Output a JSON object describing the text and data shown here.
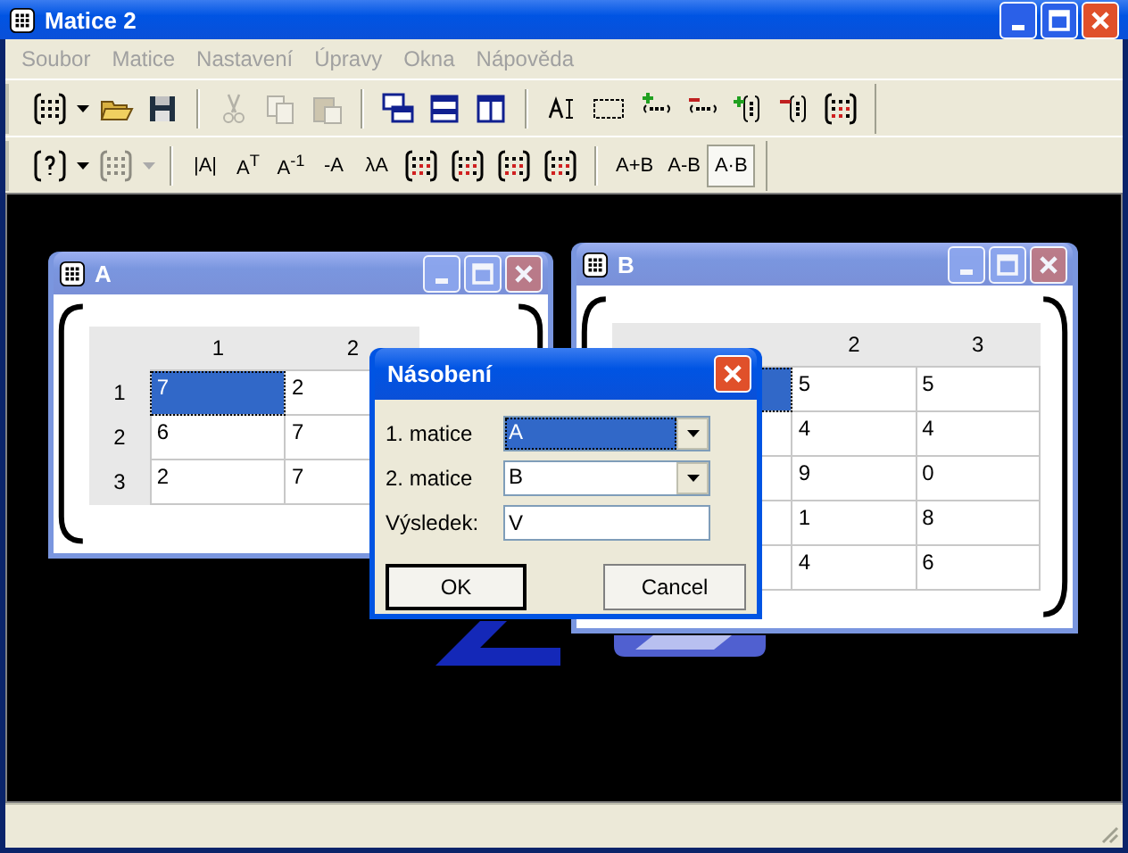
{
  "window": {
    "title": "Matice 2",
    "active": true
  },
  "menu": [
    {
      "label": "Soubor",
      "disabled": true
    },
    {
      "label": "Matice",
      "disabled": true
    },
    {
      "label": "Nastavení",
      "disabled": true
    },
    {
      "label": "Úpravy",
      "disabled": true
    },
    {
      "label": "Okna",
      "disabled": true
    },
    {
      "label": "Nápověda",
      "disabled": true
    }
  ],
  "toolbar_1": [
    [
      {
        "kind": "matrix",
        "disabled": false
      },
      {
        "kind": "caret",
        "disabled": false
      },
      {
        "kind": "folder",
        "disabled": false
      },
      {
        "kind": "disk",
        "disabled": false
      }
    ],
    [
      {
        "kind": "scissors",
        "disabled": true
      },
      {
        "kind": "copy",
        "disabled": true
      },
      {
        "kind": "paste",
        "disabled": true
      }
    ],
    [
      {
        "kind": "cascade",
        "disabled": false
      },
      {
        "kind": "rows",
        "disabled": false
      },
      {
        "kind": "columns",
        "disabled": false
      }
    ],
    [
      {
        "kind": "text-cursor",
        "disabled": false
      },
      {
        "kind": "selection",
        "disabled": false
      },
      {
        "kind": "add-row",
        "disabled": false
      },
      {
        "kind": "remove-row",
        "disabled": false
      },
      {
        "kind": "add-column",
        "disabled": false
      },
      {
        "kind": "remove-column",
        "disabled": false
      },
      {
        "kind": "matrix-op",
        "disabled": false
      }
    ]
  ],
  "toolbar_2": [
    [
      {
        "kind": "help",
        "disabled": false
      },
      {
        "kind": "caret",
        "disabled": false
      },
      {
        "kind": "matrix",
        "disabled": true
      },
      {
        "kind": "caret",
        "disabled": true
      }
    ],
    [
      {
        "kind": "text",
        "label": "|A|",
        "disabled": false,
        "pressed": false
      },
      {
        "kind": "text",
        "label": "A$^{T}$",
        "disabled": false,
        "pressed": false
      },
      {
        "kind": "text",
        "label": "A$^{-1}$",
        "disabled": false,
        "pressed": false
      },
      {
        "kind": "text",
        "label": "-A",
        "disabled": false,
        "pressed": false
      },
      {
        "kind": "text",
        "label": "λA",
        "disabled": false,
        "pressed": false
      },
      {
        "kind": "matrix-op",
        "disabled": false
      },
      {
        "kind": "matrix-op",
        "disabled": false
      },
      {
        "kind": "matrix-op",
        "disabled": false
      },
      {
        "kind": "matrix-op",
        "disabled": false
      }
    ],
    [
      {
        "kind": "text",
        "label": "A+B",
        "disabled": false,
        "pressed": false
      },
      {
        "kind": "text",
        "label": "A-B",
        "disabled": false,
        "pressed": false
      },
      {
        "kind": "text",
        "label": "A·B",
        "disabled": false,
        "pressed": true
      }
    ]
  ],
  "windows": [
    {
      "title": "A",
      "active": false,
      "columns": [
        "1",
        "2"
      ],
      "rows": [
        {
          "header": "1",
          "cells": [
            {
              "text": "7",
              "selected": true
            },
            {
              "text": "2",
              "selected": false
            }
          ]
        },
        {
          "header": "2",
          "cells": [
            {
              "text": "6",
              "selected": false
            },
            {
              "text": "7",
              "selected": false
            }
          ]
        },
        {
          "header": "3",
          "cells": [
            {
              "text": "2",
              "selected": false
            },
            {
              "text": "7",
              "selected": false
            }
          ]
        }
      ]
    },
    {
      "title": "B",
      "active": false,
      "columns": [
        "",
        "2",
        "3"
      ],
      "rows": [
        {
          "cells": [
            {
              "selected": true
            },
            {
              "text": "5",
              "selected": false
            },
            {
              "text": "5",
              "selected": false
            }
          ]
        },
        {
          "cells": [
            {
              "selected": false
            },
            {
              "text": "4",
              "selected": false
            },
            {
              "text": "4",
              "selected": false
            }
          ]
        },
        {
          "cells": [
            {
              "selected": false
            },
            {
              "text": "9",
              "selected": false
            },
            {
              "text": "0",
              "selected": false
            }
          ]
        },
        {
          "cells": [
            {
              "selected": false
            },
            {
              "text": "1",
              "selected": false
            },
            {
              "text": "8",
              "selected": false
            }
          ]
        },
        {
          "cells": [
            {
              "selected": false
            },
            {
              "text": "4",
              "selected": false
            },
            {
              "text": "6",
              "selected": false
            }
          ]
        }
      ]
    }
  ],
  "dialog": {
    "title": "Násobení",
    "active": true,
    "fields": [
      {
        "kind": "combo",
        "label": "1. matice",
        "value": "A",
        "focused": true
      },
      {
        "kind": "combo",
        "label": "2. matice",
        "value": "B",
        "focused": false
      },
      {
        "kind": "text",
        "label": "Výsledek:",
        "value": "V",
        "focused": false
      }
    ],
    "buttons": [
      {
        "label": "OK",
        "default": true
      },
      {
        "label": "Cancel",
        "default": false
      }
    ]
  }
}
